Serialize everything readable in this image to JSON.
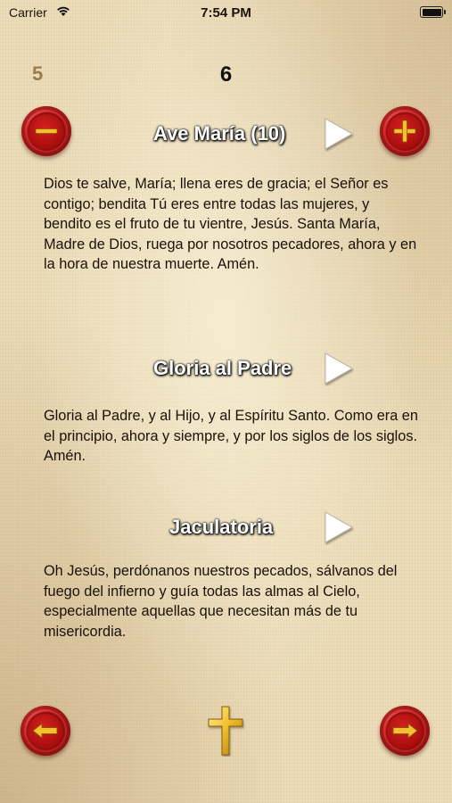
{
  "status_bar": {
    "carrier": "Carrier",
    "time": "7:54 PM"
  },
  "counter": {
    "previous": "5",
    "current": "6"
  },
  "sections": [
    {
      "title": "Ave María (10)",
      "text": "Dios te salve, María; llena eres de gracia; el Señor es contigo; bendita Tú eres entre todas las mujeres, y bendito es el fruto de tu vientre, Jesús. Santa María, Madre de Dios, ruega por nosotros pecadores, ahora y en la hora de nuestra muerte. Amén."
    },
    {
      "title": "Gloria al Padre",
      "text": "Gloria al Padre, y al Hijo, y al Espíritu Santo. Como era en el principio, ahora y siempre, y por los siglos de los siglos. Amén."
    },
    {
      "title": "Jaculatoria",
      "text": "Oh Jesús, perdónanos nuestros pecados, sálvanos del fuego del infierno y guía todas las almas al Cielo, especialmente aquellas que necesitan más de tu misericordia."
    }
  ],
  "icons": {
    "decrease": "minus-icon",
    "increase": "plus-icon",
    "play": "play-icon",
    "back": "arrow-left-icon",
    "forward": "arrow-right-icon",
    "center": "cross-icon"
  },
  "colors": {
    "parchment": "#ecdcb8",
    "seal_red": "#c01a1a",
    "gold": "#e8b830",
    "previous_count": "#9a7c4c"
  }
}
